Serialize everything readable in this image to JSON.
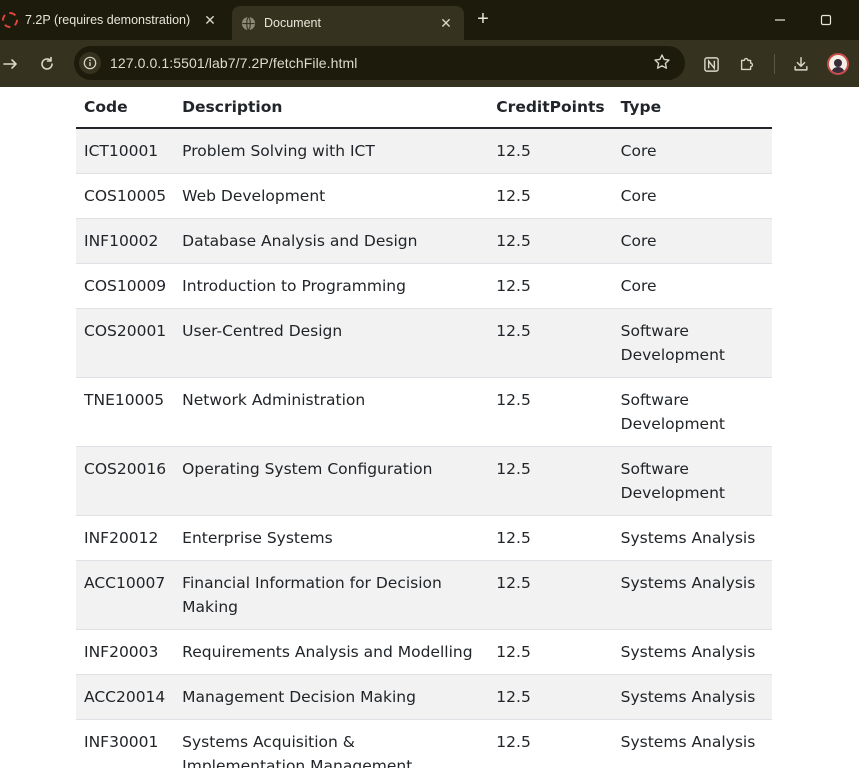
{
  "browser": {
    "tabs": [
      {
        "title": "7.2P (requires demonstration)",
        "active": false
      },
      {
        "title": "Document",
        "active": true
      }
    ],
    "url": "127.0.0.1:5501/lab7/7.2P/fetchFile.html"
  },
  "table": {
    "headers": [
      "Code",
      "Description",
      "CreditPoints",
      "Type"
    ],
    "rows": [
      [
        "ICT10001",
        "Problem Solving with ICT",
        "12.5",
        "Core"
      ],
      [
        "COS10005",
        "Web Development",
        "12.5",
        "Core"
      ],
      [
        "INF10002",
        "Database Analysis and Design",
        "12.5",
        "Core"
      ],
      [
        "COS10009",
        "Introduction to Programming",
        "12.5",
        "Core"
      ],
      [
        "COS20001",
        "User-Centred Design",
        "12.5",
        "Software Development"
      ],
      [
        "TNE10005",
        "Network Administration",
        "12.5",
        "Software Development"
      ],
      [
        "COS20016",
        "Operating System Configuration",
        "12.5",
        "Software Development"
      ],
      [
        "INF20012",
        "Enterprise Systems",
        "12.5",
        "Systems Analysis"
      ],
      [
        "ACC10007",
        "Financial Information for Decision Making",
        "12.5",
        "Systems Analysis"
      ],
      [
        "INF20003",
        "Requirements Analysis and Modelling",
        "12.5",
        "Systems Analysis"
      ],
      [
        "ACC20014",
        "Management Decision Making",
        "12.5",
        "Systems Analysis"
      ],
      [
        "INF30001",
        "Systems Acquisition & Implementation Management",
        "12.5",
        "Systems Analysis"
      ]
    ]
  },
  "icons": {
    "tab_inactive_favicon": "loading-spinner-icon",
    "tab_active_favicon": "globe-icon",
    "close": "close-icon",
    "new_tab": "plus-icon",
    "minimize": "minimize-icon",
    "maximize": "maximize-icon",
    "forward": "forward-arrow-icon",
    "reload": "reload-icon",
    "site_info": "info-icon",
    "bookmark": "star-icon",
    "notion": "notion-icon",
    "extensions": "puzzle-icon",
    "downloads": "download-icon",
    "profile": "avatar-icon"
  },
  "colors": {
    "tabstrip_bg": "#1c1b0c",
    "toolbar_bg": "#35331f",
    "stripe_bg": "#f2f2f2",
    "text": "#212529"
  }
}
